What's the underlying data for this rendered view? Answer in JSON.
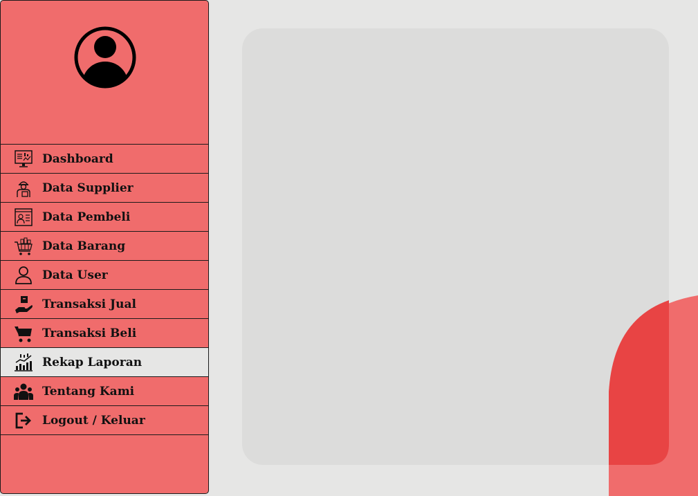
{
  "sidebar": {
    "avatar_icon": "user-circle-icon",
    "items": [
      {
        "label": "Dashboard",
        "icon": "dashboard-monitor-icon"
      },
      {
        "label": "Data Supplier",
        "icon": "supplier-worker-icon"
      },
      {
        "label": "Data Pembeli",
        "icon": "buyer-profile-icon"
      },
      {
        "label": "Data Barang",
        "icon": "shopping-cart-goods-icon"
      },
      {
        "label": "Data User",
        "icon": "user-outline-icon"
      },
      {
        "label": "Transaksi Jual",
        "icon": "hand-box-icon"
      },
      {
        "label": "Transaksi Beli",
        "icon": "cart-icon"
      },
      {
        "label": "Rekap Laporan",
        "icon": "report-chart-icon",
        "active": true
      },
      {
        "label": "Tentang Kami",
        "icon": "users-group-icon"
      },
      {
        "label": "Logout / Keluar",
        "icon": "logout-icon"
      }
    ]
  },
  "colors": {
    "sidebar_bg": "#f06c6c",
    "active_item_bg": "#e6e6e5",
    "page_bg": "#e6e6e5",
    "panel_bg": "#dcdcdb",
    "accent_dark": "#e84444"
  }
}
